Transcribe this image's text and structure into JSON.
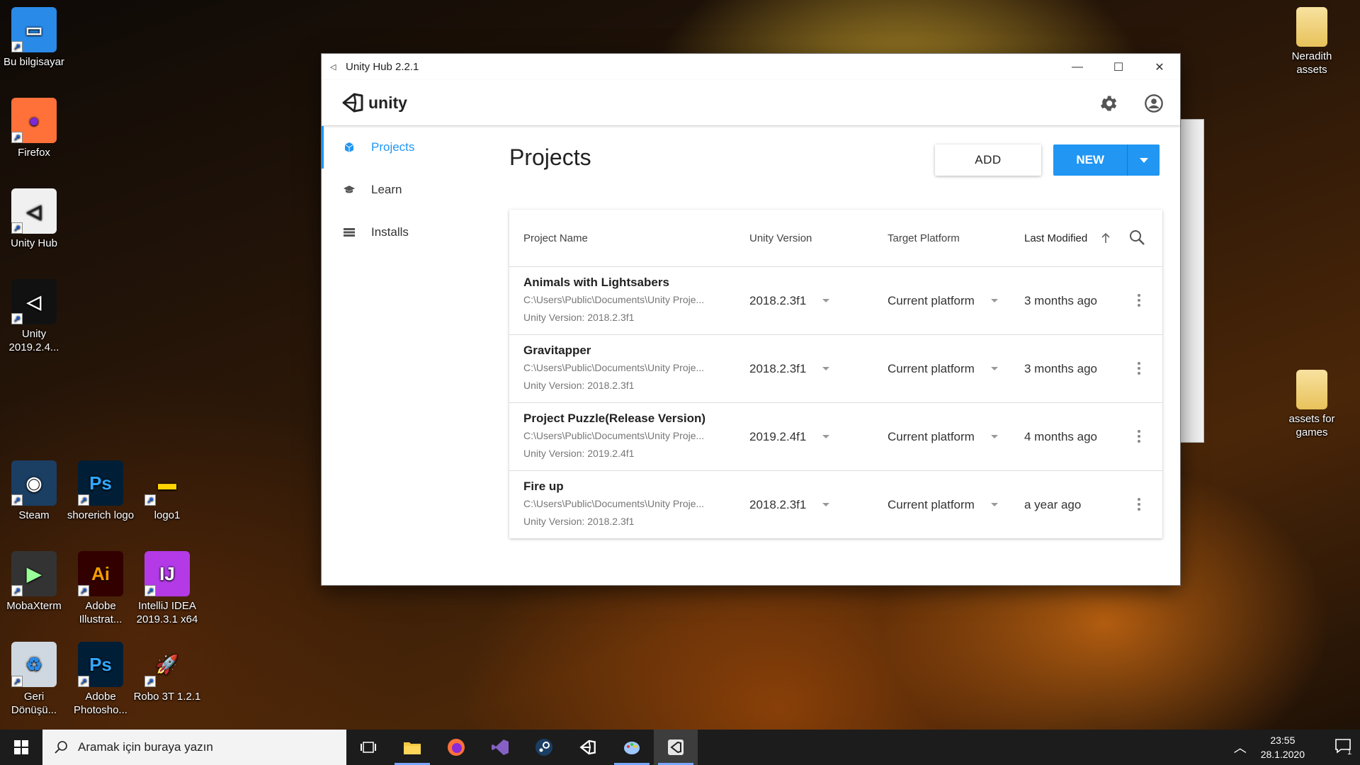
{
  "desktop": {
    "left_icons": [
      {
        "label": "Bu bilgisayar",
        "icon": "computer-icon"
      },
      {
        "label": "Firefox",
        "icon": "firefox-icon"
      },
      {
        "label": "Unity Hub",
        "icon": "unity-hub-icon"
      },
      {
        "label": "Unity 2019.2.4...",
        "icon": "unity-icon"
      },
      {
        "label": "Steam",
        "icon": "steam-icon"
      },
      {
        "label": "shorerich logo",
        "icon": "photoshop-psd-icon"
      },
      {
        "label": "logo1",
        "icon": "image-file-icon"
      },
      {
        "label": "MobaXterm",
        "icon": "mobaxterm-icon"
      },
      {
        "label": "Adobe Illustrat...",
        "icon": "illustrator-icon"
      },
      {
        "label": "IntelliJ IDEA 2019.3.1 x64",
        "icon": "intellij-icon"
      },
      {
        "label": "Geri Dönüşü...",
        "icon": "recycle-bin-icon"
      },
      {
        "label": "Adobe Photosho...",
        "icon": "photoshop-icon"
      },
      {
        "label": "Robo 3T 1.2.1",
        "icon": "robo3t-icon"
      }
    ],
    "right_icons": [
      {
        "label": "Neradith assets",
        "icon": "folder-icon"
      },
      {
        "label": "assets for games",
        "icon": "folder-icon"
      }
    ]
  },
  "window": {
    "title": "Unity Hub 2.2.1",
    "logo_text": "unity"
  },
  "sidebar": {
    "items": [
      {
        "label": "Projects",
        "icon": "cube-icon",
        "active": true
      },
      {
        "label": "Learn",
        "icon": "graduation-cap-icon",
        "active": false
      },
      {
        "label": "Installs",
        "icon": "list-icon",
        "active": false
      }
    ]
  },
  "main": {
    "title": "Projects",
    "add_label": "ADD",
    "new_label": "NEW"
  },
  "table": {
    "headers": {
      "name": "Project Name",
      "version": "Unity Version",
      "platform": "Target Platform",
      "modified": "Last Modified"
    },
    "rows": [
      {
        "name": "Animals with Lightsabers",
        "path": "C:\\Users\\Public\\Documents\\Unity Proje...",
        "version_line": "Unity Version: 2018.2.3f1",
        "version": "2018.2.3f1",
        "platform": "Current platform",
        "modified": "3 months ago"
      },
      {
        "name": "Gravitapper",
        "path": "C:\\Users\\Public\\Documents\\Unity Proje...",
        "version_line": "Unity Version: 2018.2.3f1",
        "version": "2018.2.3f1",
        "platform": "Current platform",
        "modified": "3 months ago"
      },
      {
        "name": "Project Puzzle(Release Version)",
        "path": "C:\\Users\\Public\\Documents\\Unity Proje...",
        "version_line": "Unity Version: 2019.2.4f1",
        "version": "2019.2.4f1",
        "platform": "Current platform",
        "modified": "4 months ago"
      },
      {
        "name": "Fire up",
        "path": "C:\\Users\\Public\\Documents\\Unity Proje...",
        "version_line": "Unity Version: 2018.2.3f1",
        "version": "2018.2.3f1",
        "platform": "Current platform",
        "modified": "a year ago"
      }
    ]
  },
  "taskbar": {
    "search_placeholder": "Aramak için buraya yazın",
    "time": "23:55",
    "date": "28.1.2020",
    "notification_count": "1"
  },
  "colors": {
    "accent": "#2196f3"
  }
}
